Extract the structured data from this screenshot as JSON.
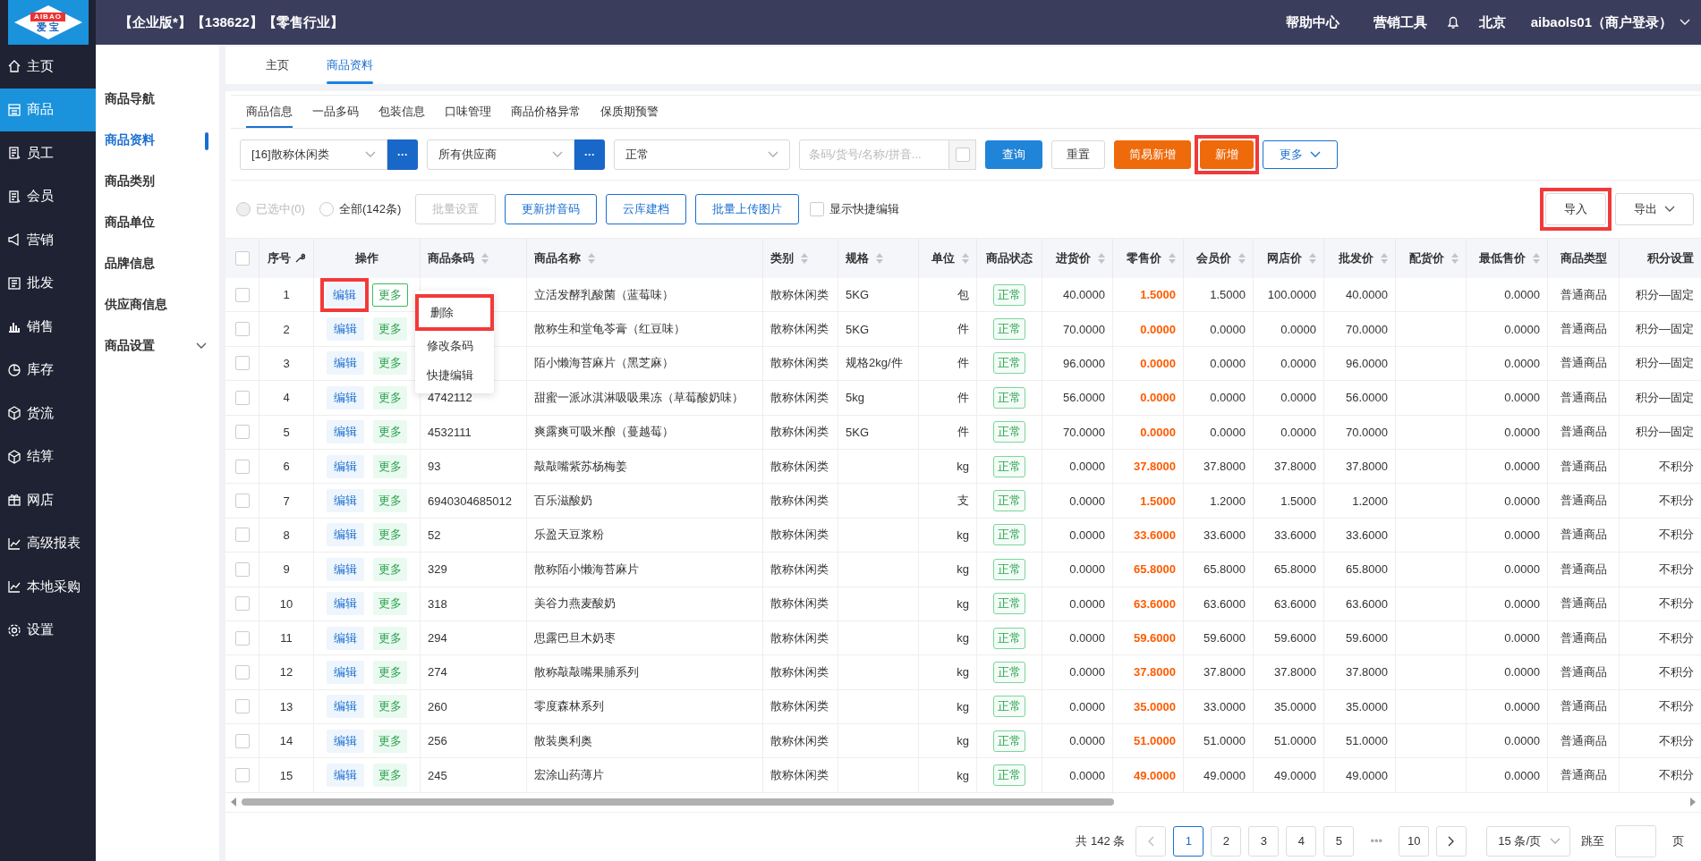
{
  "logo": {
    "text": "AIBAO",
    "subtext": "爱 宝"
  },
  "header": {
    "title": "【企业版*】【138622】【零售行业】",
    "links": [
      "帮助中心",
      "营销工具"
    ],
    "city": "北京",
    "user": "aibaols01（商户登录）"
  },
  "sidebar": {
    "items": [
      {
        "label": "主页",
        "selected": false
      },
      {
        "label": "商品",
        "selected": true
      },
      {
        "label": "员工",
        "selected": false
      },
      {
        "label": "会员",
        "selected": false
      },
      {
        "label": "营销",
        "selected": false
      },
      {
        "label": "批发",
        "selected": false
      },
      {
        "label": "销售",
        "selected": false
      },
      {
        "label": "库存",
        "selected": false
      },
      {
        "label": "货流",
        "selected": false
      },
      {
        "label": "结算",
        "selected": false
      },
      {
        "label": "网店",
        "selected": false
      },
      {
        "label": "高级报表",
        "selected": false
      },
      {
        "label": "本地采购",
        "selected": false
      },
      {
        "label": "设置",
        "selected": false
      }
    ]
  },
  "subnav": {
    "items": [
      {
        "label": "商品导航",
        "selected": false
      },
      {
        "label": "商品资料",
        "selected": true
      },
      {
        "label": "商品类别",
        "selected": false
      },
      {
        "label": "商品单位",
        "selected": false
      },
      {
        "label": "品牌信息",
        "selected": false
      },
      {
        "label": "供应商信息",
        "selected": false
      },
      {
        "label": "商品设置",
        "selected": false,
        "expandable": true
      }
    ]
  },
  "page_tabs": [
    {
      "label": "主页",
      "selected": false
    },
    {
      "label": "商品资料",
      "selected": true
    }
  ],
  "sub_tabs": [
    {
      "label": "商品信息",
      "selected": true
    },
    {
      "label": "一品多码",
      "selected": false
    },
    {
      "label": "包装信息",
      "selected": false
    },
    {
      "label": "口味管理",
      "selected": false
    },
    {
      "label": "商品价格异常",
      "selected": false
    },
    {
      "label": "保质期预警",
      "selected": false
    }
  ],
  "filters": {
    "category": "[16]散称休闲类",
    "category_button": "···",
    "supplier": "所有供应商",
    "supplier_button": "···",
    "status": "正常",
    "search_placeholder": "条码/货号/名称/拼音...",
    "search_checked": false
  },
  "filter_buttons": [
    {
      "label": "查询",
      "kind": "primary",
      "highlighted": false
    },
    {
      "label": "重置",
      "kind": "plain",
      "highlighted": false
    },
    {
      "label": "简易新增",
      "kind": "orange",
      "highlighted": false
    },
    {
      "label": "新增",
      "kind": "orange",
      "highlighted": true
    },
    {
      "label": "更多",
      "kind": "dropdown",
      "highlighted": false
    }
  ],
  "scope": [
    {
      "label": "已选中(0)",
      "selected": false,
      "disabled": true
    },
    {
      "label": "全部(142条)",
      "selected": false,
      "disabled": false
    }
  ],
  "action_buttons": [
    {
      "label": "批量设置",
      "disabled": true
    },
    {
      "label": "更新拼音码",
      "disabled": false
    },
    {
      "label": "云库建档",
      "disabled": false
    },
    {
      "label": "批量上传图片",
      "disabled": false
    }
  ],
  "quick_edit": {
    "label": "显示快捷编辑",
    "checked": false
  },
  "io_buttons": [
    {
      "label": "导入",
      "kind": "plain",
      "highlighted": true
    },
    {
      "label": "导出",
      "kind": "dropdown",
      "highlighted": false
    }
  ],
  "table": {
    "all_checked": false,
    "columns": [
      {
        "label": "序号",
        "sortable": false
      },
      {
        "label": "操作",
        "sortable": false
      },
      {
        "label": "商品条码",
        "sortable": true
      },
      {
        "label": "商品名称",
        "sortable": true
      },
      {
        "label": "类别",
        "sortable": true
      },
      {
        "label": "规格",
        "sortable": true
      },
      {
        "label": "单位",
        "sortable": true
      },
      {
        "label": "商品状态",
        "sortable": false
      },
      {
        "label": "进货价",
        "sortable": true
      },
      {
        "label": "零售价",
        "sortable": true
      },
      {
        "label": "会员价",
        "sortable": true
      },
      {
        "label": "网店价",
        "sortable": true
      },
      {
        "label": "批发价",
        "sortable": true
      },
      {
        "label": "配货价",
        "sortable": true
      },
      {
        "label": "最低售价",
        "sortable": true
      },
      {
        "label": "商品类型",
        "sortable": false
      },
      {
        "label": "积分设置",
        "sortable": false
      }
    ],
    "rows": [
      {
        "checked": false,
        "no": "1",
        "edit": "编辑",
        "more": "更多",
        "edit_highlighted": true,
        "name": "立活发酵乳酸菌（蓝莓味）",
        "category": "散称休闲类",
        "spec": "5KG",
        "unit": "包",
        "status": "正常",
        "cost": "40.0000",
        "retail": "1.5000",
        "member": "1.5000",
        "online": "100.0000",
        "wholesale": "40.0000",
        "min_price": "0.0000",
        "type": "普通商品",
        "points": "积分—固定"
      },
      {
        "checked": false,
        "no": "2",
        "edit": "编辑",
        "more": "更多",
        "edit_highlighted": false,
        "name": "散称生和堂龟苓膏（红豆味）",
        "category": "散称休闲类",
        "spec": "5KG",
        "unit": "件",
        "status": "正常",
        "cost": "70.0000",
        "retail": "0.0000",
        "member": "0.0000",
        "online": "0.0000",
        "wholesale": "70.0000",
        "min_price": "0.0000",
        "type": "普通商品",
        "points": "积分—固定"
      },
      {
        "checked": false,
        "no": "3",
        "edit": "编辑",
        "more": "更多",
        "edit_highlighted": false,
        "name": "陌小懒海苔麻片（黑芝麻）",
        "category": "散称休闲类",
        "spec": "规格2kg/件",
        "unit": "件",
        "status": "正常",
        "cost": "96.0000",
        "retail": "0.0000",
        "member": "0.0000",
        "online": "0.0000",
        "wholesale": "96.0000",
        "min_price": "0.0000",
        "type": "普通商品",
        "points": "积分—固定"
      },
      {
        "checked": false,
        "no": "4",
        "edit": "编辑",
        "more": "更多",
        "edit_highlighted": false,
        "barcode": "4742112",
        "name": "甜蜜一派冰淇淋吸吸果冻（草莓酸奶味）",
        "category": "散称休闲类",
        "spec": "5kg",
        "unit": "件",
        "status": "正常",
        "cost": "56.0000",
        "retail": "0.0000",
        "member": "0.0000",
        "online": "0.0000",
        "wholesale": "56.0000",
        "min_price": "0.0000",
        "type": "普通商品",
        "points": "积分—固定"
      },
      {
        "checked": false,
        "no": "5",
        "edit": "编辑",
        "more": "更多",
        "edit_highlighted": false,
        "barcode": "4532111",
        "name": "爽露爽可吸米酿（蔓越莓）",
        "category": "散称休闲类",
        "spec": "5KG",
        "unit": "件",
        "status": "正常",
        "cost": "70.0000",
        "retail": "0.0000",
        "member": "0.0000",
        "online": "0.0000",
        "wholesale": "70.0000",
        "min_price": "0.0000",
        "type": "普通商品",
        "points": "积分—固定"
      },
      {
        "checked": false,
        "no": "6",
        "edit": "编辑",
        "more": "更多",
        "edit_highlighted": false,
        "barcode": "93",
        "name": "敲敲嘴紫苏杨梅姜",
        "category": "散称休闲类",
        "unit": "kg",
        "status": "正常",
        "cost": "0.0000",
        "retail": "37.8000",
        "member": "37.8000",
        "online": "37.8000",
        "wholesale": "37.8000",
        "min_price": "0.0000",
        "type": "普通商品",
        "points": "不积分"
      },
      {
        "checked": false,
        "no": "7",
        "edit": "编辑",
        "more": "更多",
        "edit_highlighted": false,
        "barcode": "6940304685012",
        "name": "百乐滋酸奶",
        "category": "散称休闲类",
        "unit": "支",
        "status": "正常",
        "cost": "0.0000",
        "retail": "1.5000",
        "member": "1.2000",
        "online": "1.5000",
        "wholesale": "1.2000",
        "min_price": "0.0000",
        "type": "普通商品",
        "points": "不积分"
      },
      {
        "checked": false,
        "no": "8",
        "edit": "编辑",
        "more": "更多",
        "edit_highlighted": false,
        "barcode": "52",
        "name": "乐盈天豆浆粉",
        "category": "散称休闲类",
        "unit": "kg",
        "status": "正常",
        "cost": "0.0000",
        "retail": "33.6000",
        "member": "33.6000",
        "online": "33.6000",
        "wholesale": "33.6000",
        "min_price": "0.0000",
        "type": "普通商品",
        "points": "不积分"
      },
      {
        "checked": false,
        "no": "9",
        "edit": "编辑",
        "more": "更多",
        "edit_highlighted": false,
        "barcode": "329",
        "name": "散称陌小懒海苔麻片",
        "category": "散称休闲类",
        "unit": "kg",
        "status": "正常",
        "cost": "0.0000",
        "retail": "65.8000",
        "member": "65.8000",
        "online": "65.8000",
        "wholesale": "65.8000",
        "min_price": "0.0000",
        "type": "普通商品",
        "points": "不积分"
      },
      {
        "checked": false,
        "no": "10",
        "edit": "编辑",
        "more": "更多",
        "edit_highlighted": false,
        "barcode": "318",
        "name": "美谷力燕麦酸奶",
        "category": "散称休闲类",
        "unit": "kg",
        "status": "正常",
        "cost": "0.0000",
        "retail": "63.6000",
        "member": "63.6000",
        "online": "63.6000",
        "wholesale": "63.6000",
        "min_price": "0.0000",
        "type": "普通商品",
        "points": "不积分"
      },
      {
        "checked": false,
        "no": "11",
        "edit": "编辑",
        "more": "更多",
        "edit_highlighted": false,
        "barcode": "294",
        "name": "思露巴旦木奶枣",
        "category": "散称休闲类",
        "unit": "kg",
        "status": "正常",
        "cost": "0.0000",
        "retail": "59.6000",
        "member": "59.6000",
        "online": "59.6000",
        "wholesale": "59.6000",
        "min_price": "0.0000",
        "type": "普通商品",
        "points": "不积分"
      },
      {
        "checked": false,
        "no": "12",
        "edit": "编辑",
        "more": "更多",
        "edit_highlighted": false,
        "barcode": "274",
        "name": "散称敲敲嘴果脯系列",
        "category": "散称休闲类",
        "unit": "kg",
        "status": "正常",
        "cost": "0.0000",
        "retail": "37.8000",
        "member": "37.8000",
        "online": "37.8000",
        "wholesale": "37.8000",
        "min_price": "0.0000",
        "type": "普通商品",
        "points": "不积分"
      },
      {
        "checked": false,
        "no": "13",
        "edit": "编辑",
        "more": "更多",
        "edit_highlighted": false,
        "barcode": "260",
        "name": "零度森林系列",
        "category": "散称休闲类",
        "unit": "kg",
        "status": "正常",
        "cost": "0.0000",
        "retail": "35.0000",
        "member": "33.0000",
        "online": "35.0000",
        "wholesale": "35.0000",
        "min_price": "0.0000",
        "type": "普通商品",
        "points": "不积分"
      },
      {
        "checked": false,
        "no": "14",
        "edit": "编辑",
        "more": "更多",
        "edit_highlighted": false,
        "barcode": "256",
        "name": "散装奥利奥",
        "category": "散称休闲类",
        "unit": "kg",
        "status": "正常",
        "cost": "0.0000",
        "retail": "51.0000",
        "member": "51.0000",
        "online": "51.0000",
        "wholesale": "51.0000",
        "min_price": "0.0000",
        "type": "普通商品",
        "points": "不积分"
      },
      {
        "checked": false,
        "no": "15",
        "edit": "编辑",
        "more": "更多",
        "edit_highlighted": false,
        "barcode": "245",
        "name": "宏涂山药薄片",
        "category": "散称休闲类",
        "unit": "kg",
        "status": "正常",
        "cost": "0.0000",
        "retail": "49.0000",
        "member": "49.0000",
        "online": "49.0000",
        "wholesale": "49.0000",
        "min_price": "0.0000",
        "type": "普通商品",
        "points": "不积分"
      }
    ]
  },
  "row_menu": {
    "items": [
      {
        "label": "删除",
        "highlighted": true
      },
      {
        "label": "修改条码",
        "highlighted": false
      },
      {
        "label": "快捷编辑",
        "highlighted": false
      }
    ]
  },
  "pagination": {
    "total": "共 142 条",
    "pages": [
      {
        "label": "1",
        "selected": true
      },
      {
        "label": "2",
        "selected": false
      },
      {
        "label": "3",
        "selected": false
      },
      {
        "label": "4",
        "selected": false
      },
      {
        "label": "5",
        "selected": false
      },
      {
        "label": "•••",
        "selected": false
      },
      {
        "label": "10",
        "selected": false
      }
    ],
    "page_size": "15 条/页",
    "jump_label": "跳至",
    "page_unit": "页"
  }
}
